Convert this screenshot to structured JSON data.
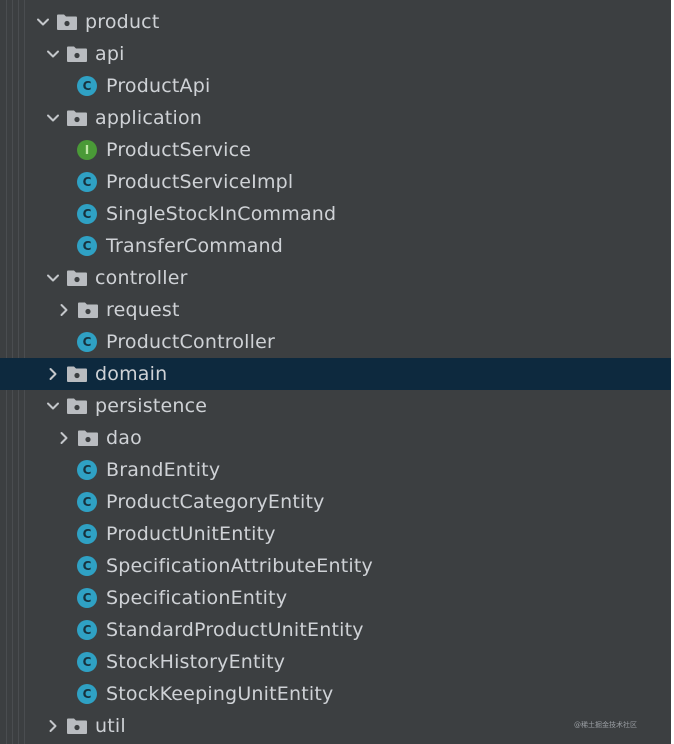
{
  "tree": {
    "items": [
      {
        "label": "product",
        "type": "folder",
        "expanded": true,
        "level": 0
      },
      {
        "label": "api",
        "type": "folder",
        "expanded": true,
        "level": 1
      },
      {
        "label": "ProductApi",
        "type": "class",
        "level": 2
      },
      {
        "label": "application",
        "type": "folder",
        "expanded": true,
        "level": 1
      },
      {
        "label": "ProductService",
        "type": "interface",
        "level": 2
      },
      {
        "label": "ProductServiceImpl",
        "type": "class",
        "level": 2
      },
      {
        "label": "SingleStockInCommand",
        "type": "class",
        "level": 2
      },
      {
        "label": "TransferCommand",
        "type": "class",
        "level": 2
      },
      {
        "label": "controller",
        "type": "folder",
        "expanded": true,
        "level": 1
      },
      {
        "label": "request",
        "type": "folder",
        "expanded": false,
        "level": 2
      },
      {
        "label": "ProductController",
        "type": "class",
        "level": 2
      },
      {
        "label": "domain",
        "type": "folder",
        "expanded": false,
        "level": 1,
        "selected": true
      },
      {
        "label": "persistence",
        "type": "folder",
        "expanded": true,
        "level": 1
      },
      {
        "label": "dao",
        "type": "folder",
        "expanded": false,
        "level": 2
      },
      {
        "label": "BrandEntity",
        "type": "class",
        "level": 2
      },
      {
        "label": "ProductCategoryEntity",
        "type": "class",
        "level": 2
      },
      {
        "label": "ProductUnitEntity",
        "type": "class",
        "level": 2
      },
      {
        "label": "SpecificationAttributeEntity",
        "type": "class",
        "level": 2
      },
      {
        "label": "SpecificationEntity",
        "type": "class",
        "level": 2
      },
      {
        "label": "StandardProductUnitEntity",
        "type": "class",
        "level": 2
      },
      {
        "label": "StockHistoryEntity",
        "type": "class",
        "level": 2
      },
      {
        "label": "StockKeepingUnitEntity",
        "type": "class",
        "level": 2
      },
      {
        "label": "util",
        "type": "folder",
        "expanded": false,
        "level": 1
      }
    ]
  },
  "icons": {
    "class": "class-c-icon",
    "interface": "interface-i-icon",
    "folder": "package-folder-icon",
    "expanded": "chevron-down-icon",
    "collapsed": "chevron-right-icon"
  },
  "badges": {
    "class": "C",
    "interface": "I"
  },
  "colors": {
    "background": "#3c3f41",
    "selected_row": "#0d293e",
    "text": "#cfd2d6",
    "class_icon": "#2fa1c4",
    "interface_icon": "#4a9a37",
    "folder_icon": "#b9bcc0"
  },
  "watermark": "@稀土掘金技术社区"
}
